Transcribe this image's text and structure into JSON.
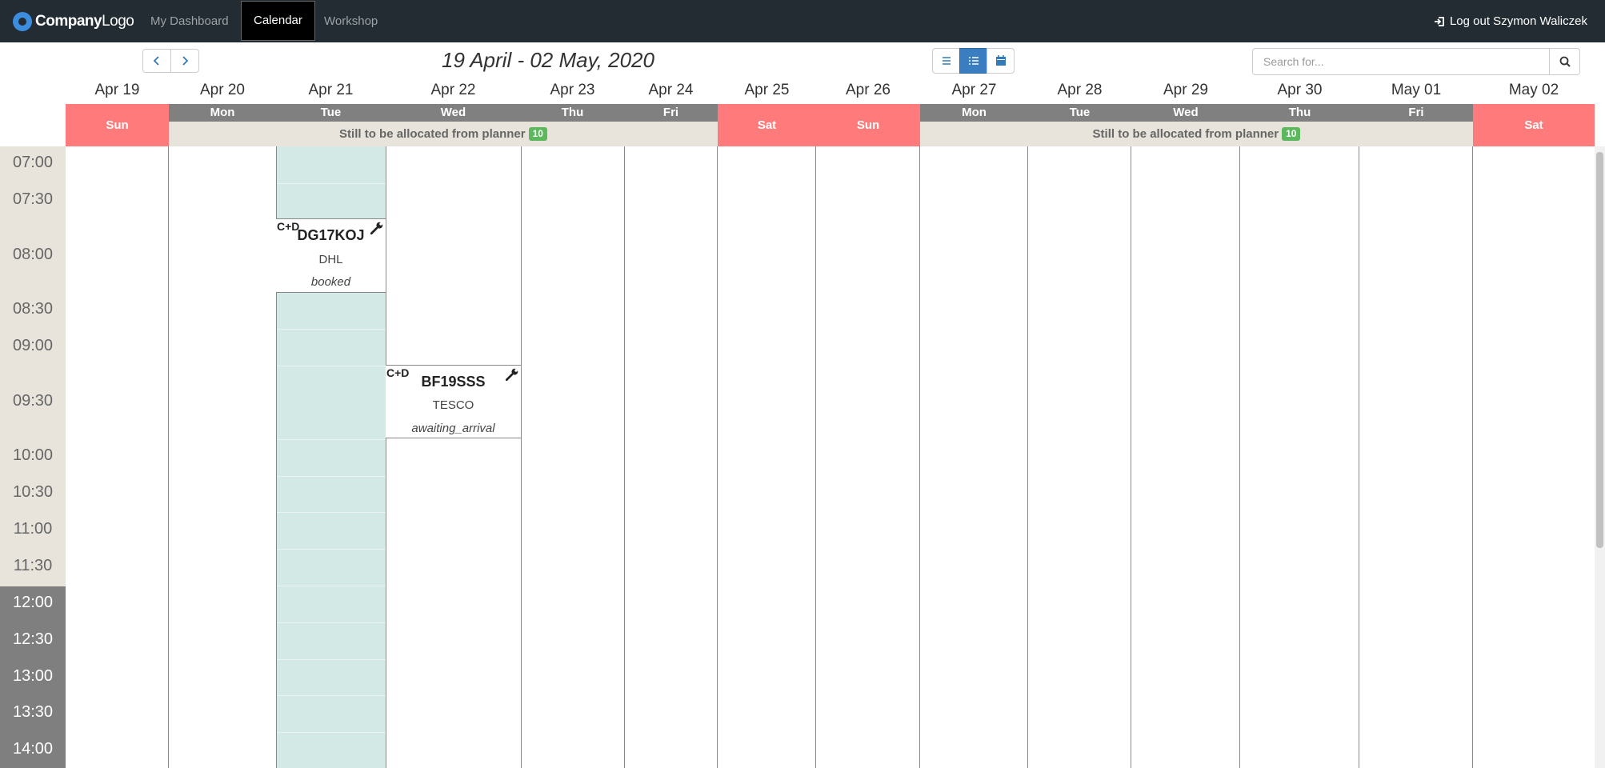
{
  "nav": {
    "brand_bold": "Company",
    "brand_light": "Logo",
    "items": [
      {
        "label": "My Dashboard",
        "active": false
      },
      {
        "label": "Calendar",
        "active": true
      },
      {
        "label": "Workshop",
        "active": false
      }
    ],
    "logout_label": "Log out Szymon Waliczek"
  },
  "toolbar": {
    "prev_icon": "chevron-left-icon",
    "next_icon": "chevron-right-icon",
    "range_title": "19 April - 02 May, 2020",
    "view_buttons": [
      {
        "icon": "list-icon",
        "active": false
      },
      {
        "icon": "detailed-list-icon",
        "active": true
      },
      {
        "icon": "calendar-icon",
        "active": false
      }
    ],
    "search_placeholder": "Search for...",
    "search_icon": "search-icon"
  },
  "days": [
    {
      "date": "Apr 19",
      "name": "Sun",
      "weekend": true
    },
    {
      "date": "Apr 20",
      "name": "Mon",
      "weekend": false
    },
    {
      "date": "Apr 21",
      "name": "Tue",
      "weekend": false
    },
    {
      "date": "Apr 22",
      "name": "Wed",
      "weekend": false
    },
    {
      "date": "Apr 23",
      "name": "Thu",
      "weekend": false
    },
    {
      "date": "Apr 24",
      "name": "Fri",
      "weekend": false
    },
    {
      "date": "Apr 25",
      "name": "Sat",
      "weekend": true
    },
    {
      "date": "Apr 26",
      "name": "Sun",
      "weekend": true
    },
    {
      "date": "Apr 27",
      "name": "Mon",
      "weekend": false
    },
    {
      "date": "Apr 28",
      "name": "Tue",
      "weekend": false
    },
    {
      "date": "Apr 29",
      "name": "Wed",
      "weekend": false
    },
    {
      "date": "Apr 30",
      "name": "Thu",
      "weekend": false
    },
    {
      "date": "May 01",
      "name": "Fri",
      "weekend": false
    },
    {
      "date": "May 02",
      "name": "Sat",
      "weekend": true
    }
  ],
  "allocation": [
    {
      "label": "Still to be allocated from planner",
      "count": "10"
    },
    {
      "label": "Still to be allocated from planner",
      "count": "10"
    }
  ],
  "times": [
    "07:00",
    "07:30",
    "08:00",
    "08:30",
    "09:00",
    "09:30",
    "10:00",
    "10:30",
    "11:00",
    "11:30",
    "12:00",
    "12:30",
    "13:00",
    "13:30",
    "14:00"
  ],
  "events": [
    {
      "type": "C+D",
      "registration": "DG17KOJ",
      "customer": "DHL",
      "status": "booked",
      "day": "Apr 21",
      "start": "07:45",
      "icon": "wrench-icon"
    },
    {
      "type": "C+D",
      "registration": "BF19SSS",
      "customer": "TESCO",
      "status": "awaiting_arrival",
      "day": "Apr 22",
      "start": "09:15",
      "icon": "wrench-icon"
    }
  ],
  "colors": {
    "navbar": "#222c32",
    "weekend": "#ff7b7b",
    "weekday_header": "#808080",
    "allocation_bg": "#e8e4dc",
    "badge": "#5cb85c",
    "highlight_day": "#d2e9e6",
    "active_view": "#3a7ec1"
  }
}
